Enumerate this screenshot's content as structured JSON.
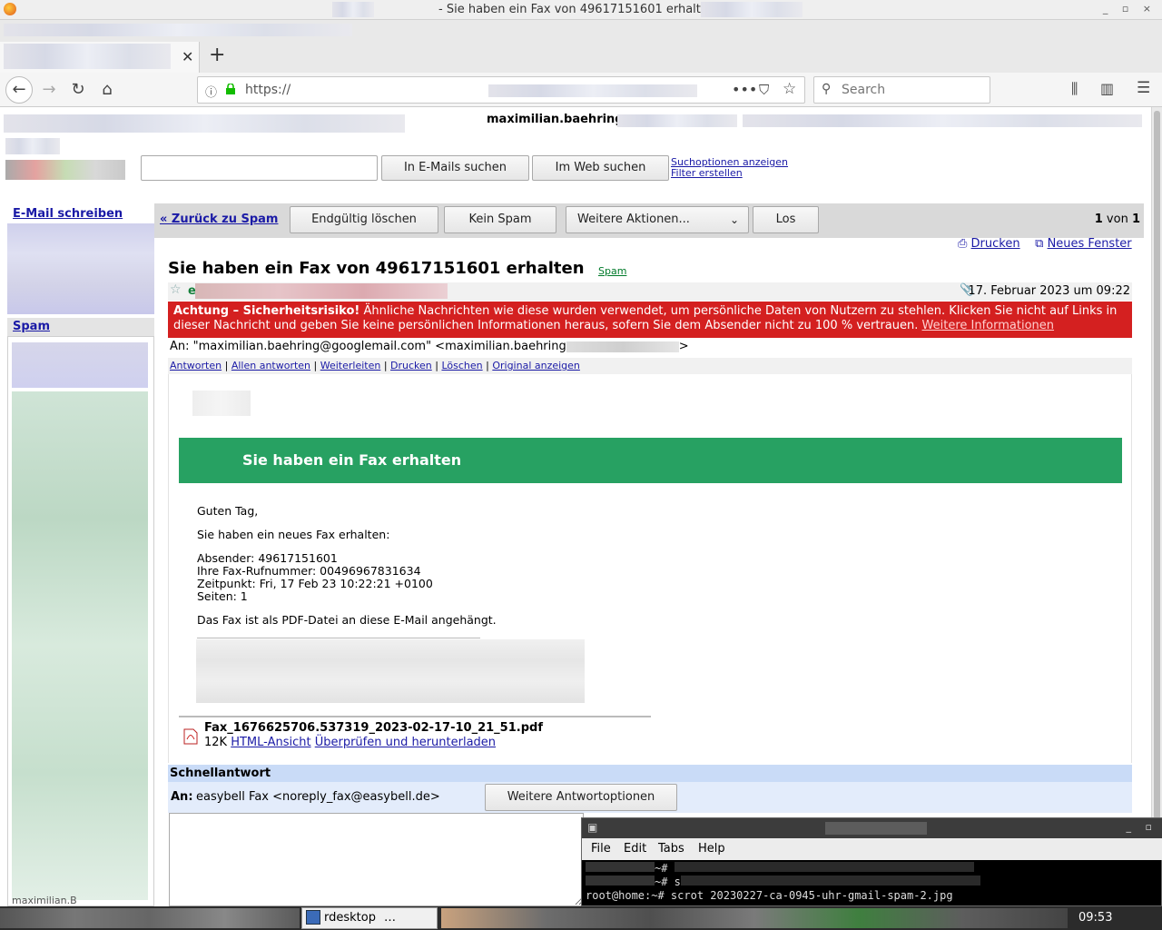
{
  "window": {
    "title": "- Sie haben ein Fax von 49617151601 erhalten -",
    "controls": "_ ▫ ×"
  },
  "browser": {
    "url": "https://",
    "search_placeholder": "Search"
  },
  "gmail": {
    "user_email": "maximilian.baehring",
    "search_mail_button": "In E-Mails suchen",
    "search_web_button": "Im Web suchen",
    "search_options_link": "Suchoptionen anzeigen",
    "create_filter_link": "Filter erstellen",
    "compose_link": "E-Mail schreiben",
    "spam_label": "Spam",
    "sidebar_bottom": "maximilian.B",
    "toolbar": {
      "back_link": "« Zurück zu Spam",
      "delete_forever": "Endgültig löschen",
      "not_spam": "Kein Spam",
      "more_actions": "Weitere Aktionen...",
      "go": "Los",
      "count_current": "1",
      "count_of": "von",
      "count_total": "1"
    },
    "print_link": "Drucken",
    "new_window_link": "Neues Fenster",
    "subject": "Sie haben ein Fax von 49617151601 erhalten",
    "subject_tag": "Spam",
    "sender_initial": "e",
    "date": "17. Februar 2023 um 09:22",
    "warning": {
      "bold": "Achtung – Sicherheitsrisiko!",
      "text": " Ähnliche Nachrichten wie diese wurden verwendet, um persönliche Daten von Nutzern zu stehlen. Klicken Sie nicht auf Links in dieser Nachricht und geben Sie keine persönlichen Informationen heraus, sofern Sie dem Absender nicht zu 100 % vertrauen.",
      "more_link": "Weitere Informationen"
    },
    "to_line": "An: \"maximilian.baehring@googlemail.com\" <maximilian.baehring",
    "actions": [
      "Antworten",
      "Allen antworten",
      "Weiterleiten",
      "Drucken",
      "Löschen",
      "Original anzeigen"
    ],
    "banner": "Sie haben ein Fax erhalten",
    "body": {
      "greeting": "Guten Tag,",
      "intro": "Sie haben ein neues Fax erhalten:",
      "sender": "Absender: 49617151601",
      "fax_number": "Ihre Fax-Rufnummer: 00496967831634",
      "time": "Zeitpunkt: Fri, 17 Feb 23 10:22:21 +0100",
      "pages": "Seiten: 1",
      "pdf_note": "Das Fax ist als PDF-Datei an diese E-Mail angehängt."
    },
    "attachment": {
      "filename": "Fax_1676625706.537319_2023-02-17-10_21_51.pdf",
      "size": "12K",
      "html_view": "HTML-Ansicht",
      "check_download": "Überprüfen und herunterladen"
    },
    "quick_reply": {
      "title": "Schnellantwort",
      "to_label": "An:",
      "to_value": "easybell Fax <noreply_fax@easybell.de>",
      "more_options": "Weitere Antwortoptionen"
    }
  },
  "terminal": {
    "menu": [
      "File",
      "Edit",
      "Tabs",
      "Help"
    ],
    "line1": "~#",
    "line2": "~# s",
    "line3": "root@home:~# scrot 20230227-ca-0945-uhr-gmail-spam-2.jpg"
  },
  "taskbar": {
    "item": "rdesktop",
    "clock": "09:53"
  },
  "colors": {
    "warning": "#d42020",
    "banner": "#27a162",
    "link": "#1a1aa6"
  }
}
